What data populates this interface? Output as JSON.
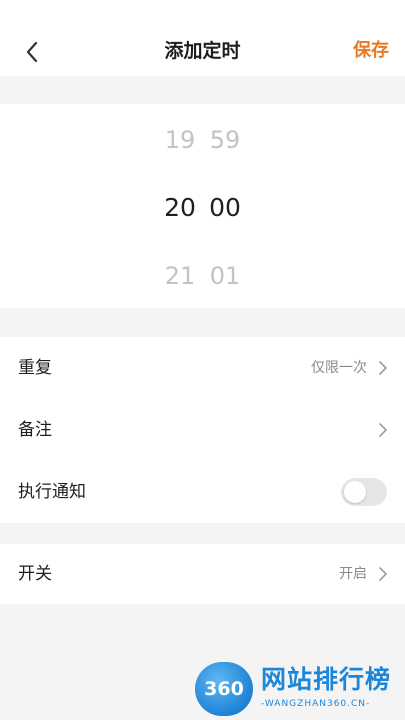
{
  "header": {
    "title": "添加定时",
    "save_label": "保存"
  },
  "picker": {
    "hours": {
      "prev": "19",
      "current": "20",
      "next": "21"
    },
    "minutes": {
      "prev": "59",
      "current": "00",
      "next": "01"
    }
  },
  "settings": {
    "repeat": {
      "label": "重复",
      "value": "仅限一次"
    },
    "note": {
      "label": "备注"
    },
    "notify": {
      "label": "执行通知",
      "enabled": false
    },
    "switch": {
      "label": "开关",
      "value": "开启"
    }
  },
  "watermark": {
    "badge": "360",
    "title": "网站排行榜",
    "subtitle": "-WANGZHAN360.CN-"
  },
  "colors": {
    "accent": "#e77a26",
    "background": "#f4f4f4",
    "toggle_off": "#e6e6e6",
    "watermark_blue": "#1c86d9"
  },
  "icons": {
    "back": "chevron-left-icon",
    "row_arrow": "chevron-right-icon"
  }
}
